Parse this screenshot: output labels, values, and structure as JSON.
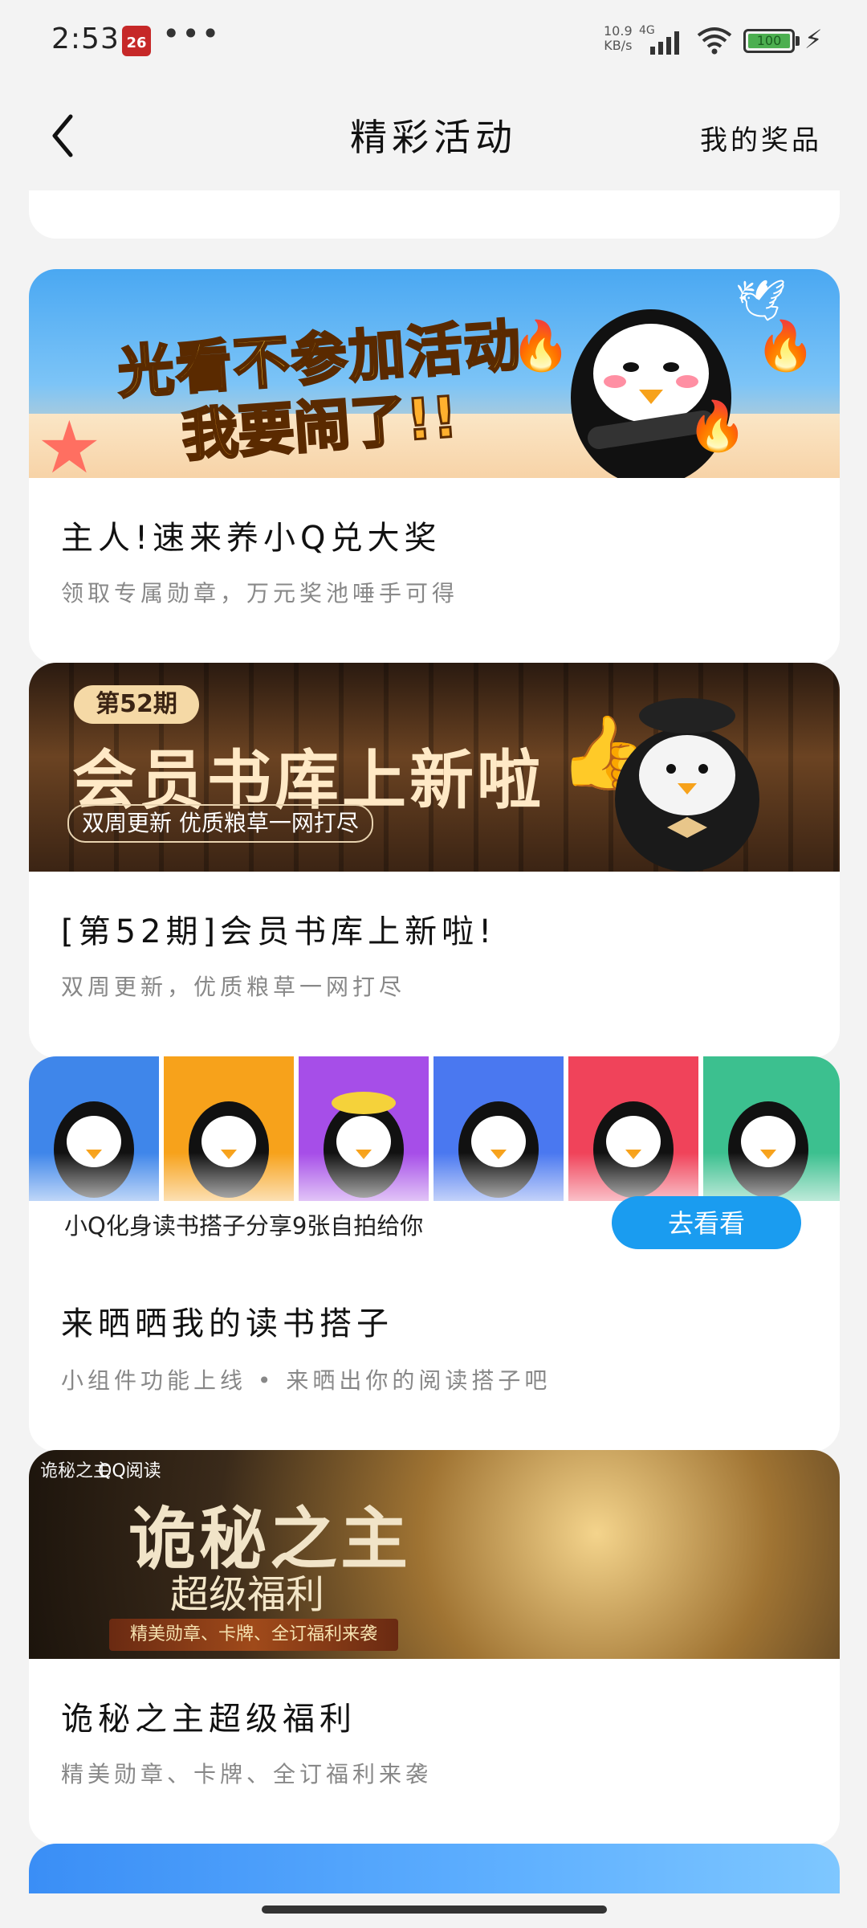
{
  "status_bar": {
    "time": "2:53",
    "calendar_day": "26",
    "more": "•••",
    "speed_value": "10.9",
    "speed_unit": "KB/s",
    "network": "4G",
    "battery": "100"
  },
  "header": {
    "title": "精彩活动",
    "right_link": "我的奖品"
  },
  "cards": [
    {
      "title": "主人!速来养小Q兑大奖",
      "subtitle": "领取专属勋章，万元奖池唾手可得",
      "banner": {
        "line1": "光看不参加活动",
        "line2": "我要闹了!!"
      }
    },
    {
      "title": "[第52期]会员书库上新啦!",
      "subtitle": "双周更新，优质粮草一网打尽",
      "banner": {
        "issue": "第52期",
        "headline": "会员书库上新啦",
        "pill": "双周更新  优质粮草一网打尽"
      }
    },
    {
      "title": "来晒晒我的读书搭子",
      "subtitle": "小组件功能上线 • 来晒出你的阅读搭子吧",
      "banner": {
        "caption": "小Q化身读书搭子分享9张自拍给你",
        "button": "去看看"
      }
    },
    {
      "title": "诡秘之主超级福利",
      "subtitle": "精美勋章、卡牌、全订福利来袭",
      "banner": {
        "logo": "诡秘之主",
        "brand": "QQ阅读",
        "t1": "诡秘之主",
        "t2": "超级福利",
        "ribbon": "精美勋章、卡牌、全订福利来袭"
      }
    }
  ],
  "colors": {
    "accent": "#1a9cf0",
    "background": "#f3f3f3",
    "card": "#ffffff"
  }
}
